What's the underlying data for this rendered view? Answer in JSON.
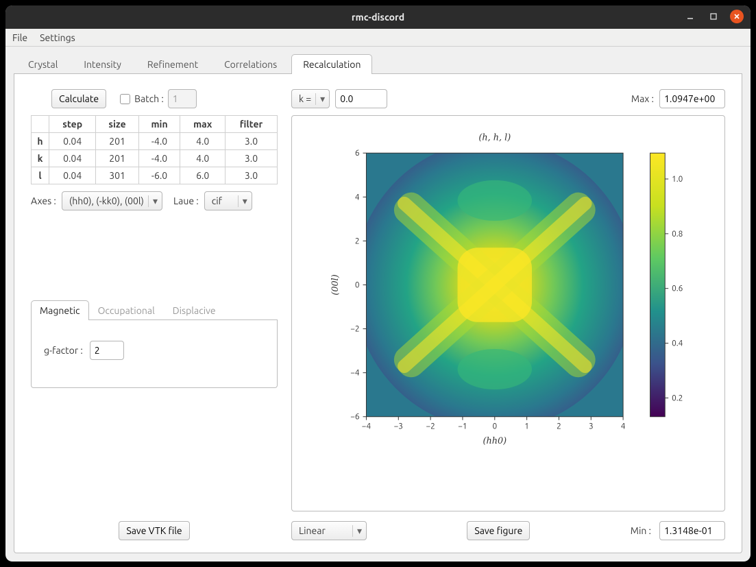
{
  "window": {
    "title": "rmc-discord"
  },
  "menu": {
    "file": "File",
    "settings": "Settings"
  },
  "tabs": [
    "Crystal",
    "Intensity",
    "Refinement",
    "Correlations",
    "Recalculation"
  ],
  "active_tab": "Recalculation",
  "calc": {
    "calculate_label": "Calculate",
    "batch_label": "Batch :",
    "batch_value": "1",
    "headers": [
      "step",
      "size",
      "min",
      "max",
      "filter"
    ],
    "rows": [
      {
        "axis": "h",
        "step": "0.04",
        "size": "201",
        "min": "-4.0",
        "max": "4.0",
        "filter": "3.0"
      },
      {
        "axis": "k",
        "step": "0.04",
        "size": "201",
        "min": "-4.0",
        "max": "4.0",
        "filter": "3.0"
      },
      {
        "axis": "l",
        "step": "0.04",
        "size": "301",
        "min": "-6.0",
        "max": "6.0",
        "filter": "3.0"
      }
    ],
    "axes_label": "Axes :",
    "axes_value": "(hh0), (-kk0), (00l)",
    "laue_label": "Laue :",
    "laue_value": "cif"
  },
  "subtabs": {
    "labels": [
      "Magnetic",
      "Occupational",
      "Displacive"
    ],
    "active": "Magnetic",
    "gfactor_label": "g-factor :",
    "gfactor_value": "2"
  },
  "left_footer": {
    "save_vtk": "Save VTK file"
  },
  "plot_controls": {
    "kselect": "k =",
    "kvalue": "0.0",
    "max_label": "Max :",
    "max_value": "1.0947e+00",
    "min_label": "Min :",
    "min_value": "1.3148e-01",
    "scale": "Linear",
    "save_figure": "Save figure"
  },
  "chart_data": {
    "type": "heatmap",
    "title": "(h, h, l)",
    "xlabel": "(hh0)",
    "ylabel": "(00l)",
    "xlim": [
      -4,
      4
    ],
    "ylim": [
      -6,
      6
    ],
    "x_ticks": [
      -4,
      -3,
      -2,
      -1,
      0,
      1,
      2,
      3,
      4
    ],
    "y_ticks": [
      -6,
      -4,
      -2,
      0,
      2,
      4,
      6
    ],
    "colorbar_ticks": [
      0.2,
      0.4,
      0.6,
      0.8,
      1.0
    ],
    "colorbar_range": [
      0.1315,
      1.0947
    ],
    "colormap": "viridis"
  }
}
